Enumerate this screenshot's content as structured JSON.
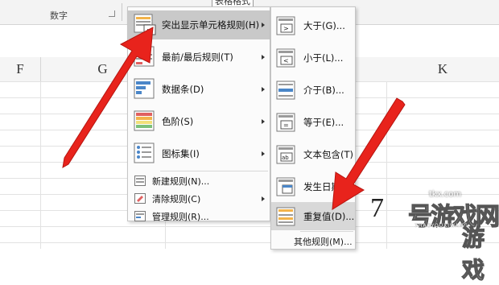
{
  "ribbon": {
    "group_label": "数字",
    "tab_fragment": "表格格式"
  },
  "columns": [
    "F",
    "G",
    "K"
  ],
  "main_menu": {
    "items": [
      {
        "label": "突出显示单元格规则(H)",
        "icon": "highlight-cells-icon",
        "submenu": true
      },
      {
        "label": "最前/最后规则(T)",
        "icon": "top-bottom-icon",
        "submenu": true
      },
      {
        "label": "数据条(D)",
        "icon": "data-bars-icon",
        "submenu": true
      },
      {
        "label": "色阶(S)",
        "icon": "color-scales-icon",
        "submenu": true
      },
      {
        "label": "图标集(I)",
        "icon": "icon-sets-icon",
        "submenu": true
      }
    ],
    "small_items": [
      {
        "label": "新建规则(N)...",
        "icon": "new-rule-icon"
      },
      {
        "label": "清除规则(C)",
        "icon": "clear-rules-icon",
        "submenu": true
      },
      {
        "label": "管理规则(R)...",
        "icon": "manage-rules-icon"
      }
    ]
  },
  "sub_menu": {
    "items": [
      {
        "label": "大于(G)...",
        "icon": "greater-than-icon"
      },
      {
        "label": "小于(L)...",
        "icon": "less-than-icon"
      },
      {
        "label": "介于(B)...",
        "icon": "between-icon"
      },
      {
        "label": "等于(E)...",
        "icon": "equal-to-icon"
      },
      {
        "label": "文本包含(T)",
        "icon": "text-contains-icon"
      },
      {
        "label": "发生日期",
        "icon": "date-occurring-icon"
      },
      {
        "label": "重复值(D)...",
        "icon": "duplicate-values-icon"
      }
    ],
    "more": "其他规则(M)..."
  },
  "colors": {
    "arrow_red": "#e8231c",
    "menu_highlight": "#c9c9c9",
    "menu_bg": "#fbfbfb"
  },
  "watermark": {
    "url": "tkx.com",
    "brand": "号游戏网",
    "sub": "7HAOYOUXIWANG",
    "big": "游戏",
    "seven": "7"
  }
}
